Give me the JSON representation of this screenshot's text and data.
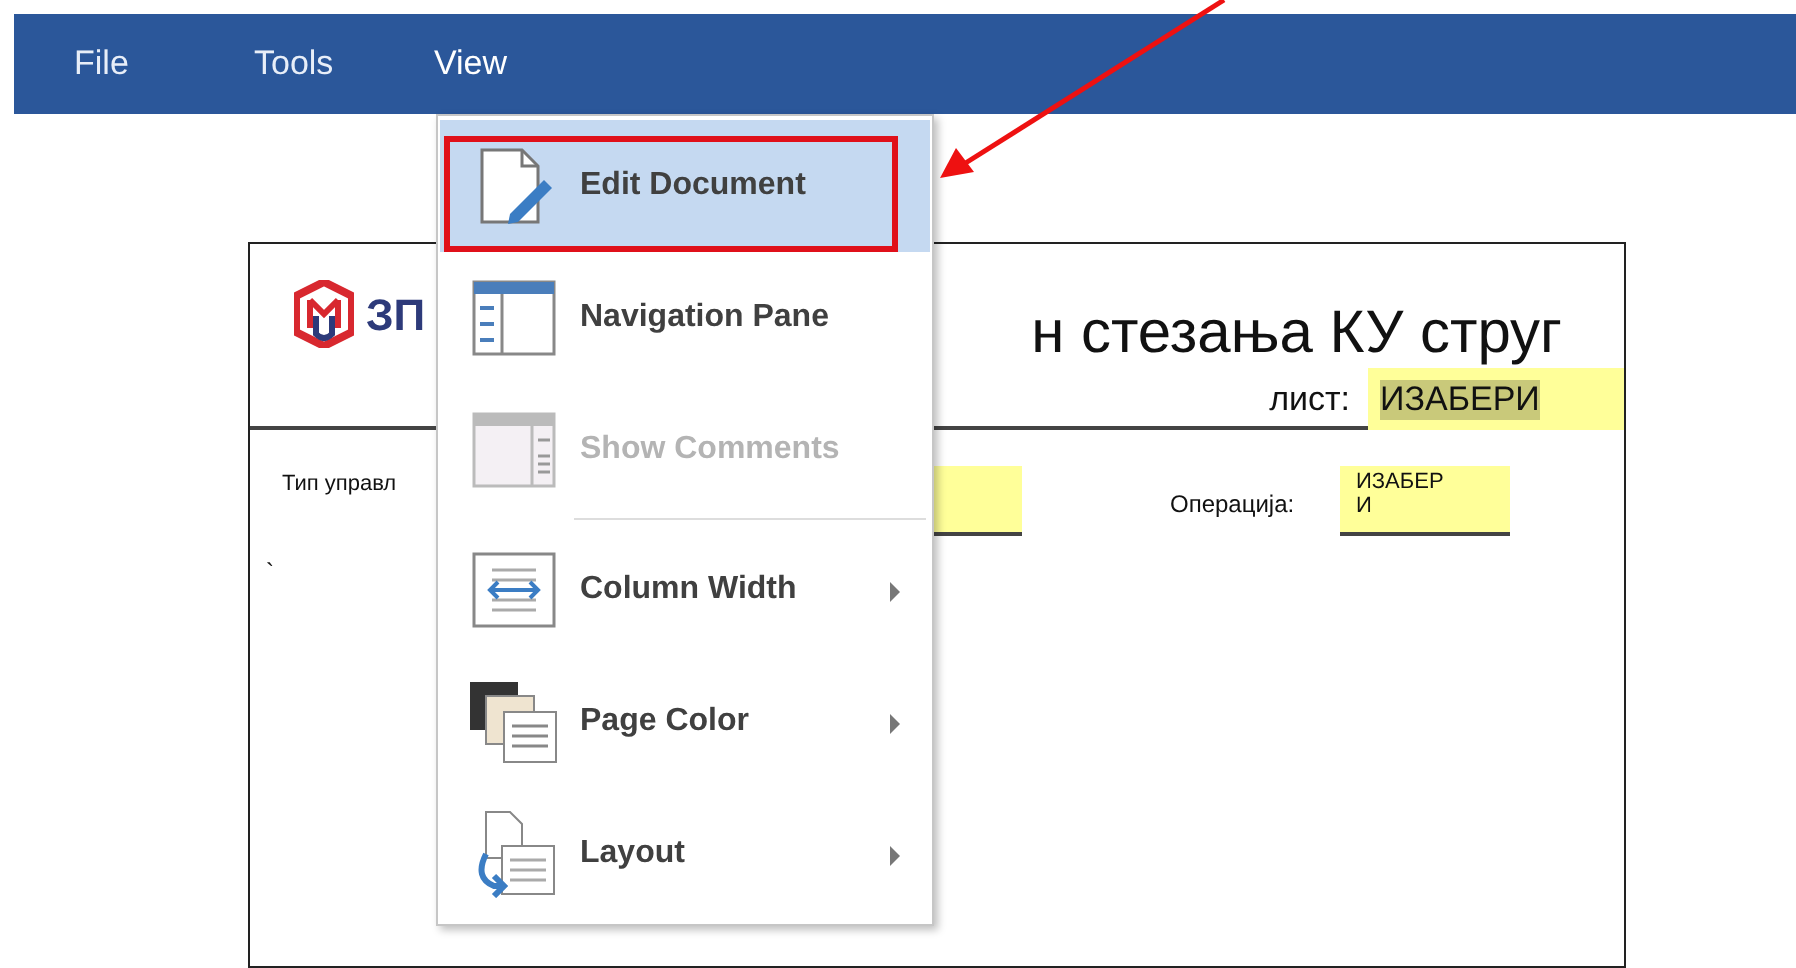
{
  "menu_bar": {
    "items": [
      {
        "label": "File",
        "selected": false
      },
      {
        "label": "Tools",
        "selected": false
      },
      {
        "label": "View",
        "selected": true
      }
    ]
  },
  "document": {
    "logo_text": "ЗП",
    "title": "н стезања КУ струг",
    "sheet_label": "лист:",
    "sheet_value": "ИЗАБЕРИ",
    "control_type_label": "Тип управл",
    "operation_label": "Операција:",
    "operation_value_lines": [
      "ИЗАБЕР",
      "И"
    ],
    "stray_mark": "`"
  },
  "view_menu": {
    "items": [
      {
        "label": "Edit Document",
        "selected": true,
        "outlined": true,
        "disabled": false,
        "submenu": false
      },
      {
        "label": "Navigation Pane",
        "selected": false,
        "outlined": false,
        "disabled": false,
        "submenu": false
      },
      {
        "label": "Show Comments",
        "selected": false,
        "outlined": false,
        "disabled": true,
        "submenu": false
      },
      {
        "kind": "separator"
      },
      {
        "label": "Column Width",
        "selected": false,
        "outlined": false,
        "disabled": false,
        "submenu": true
      },
      {
        "label": "Page Color",
        "selected": false,
        "outlined": false,
        "disabled": false,
        "submenu": true
      },
      {
        "label": "Layout",
        "selected": false,
        "outlined": false,
        "disabled": false,
        "submenu": true
      }
    ]
  },
  "callout": {
    "kind": "arrow"
  }
}
